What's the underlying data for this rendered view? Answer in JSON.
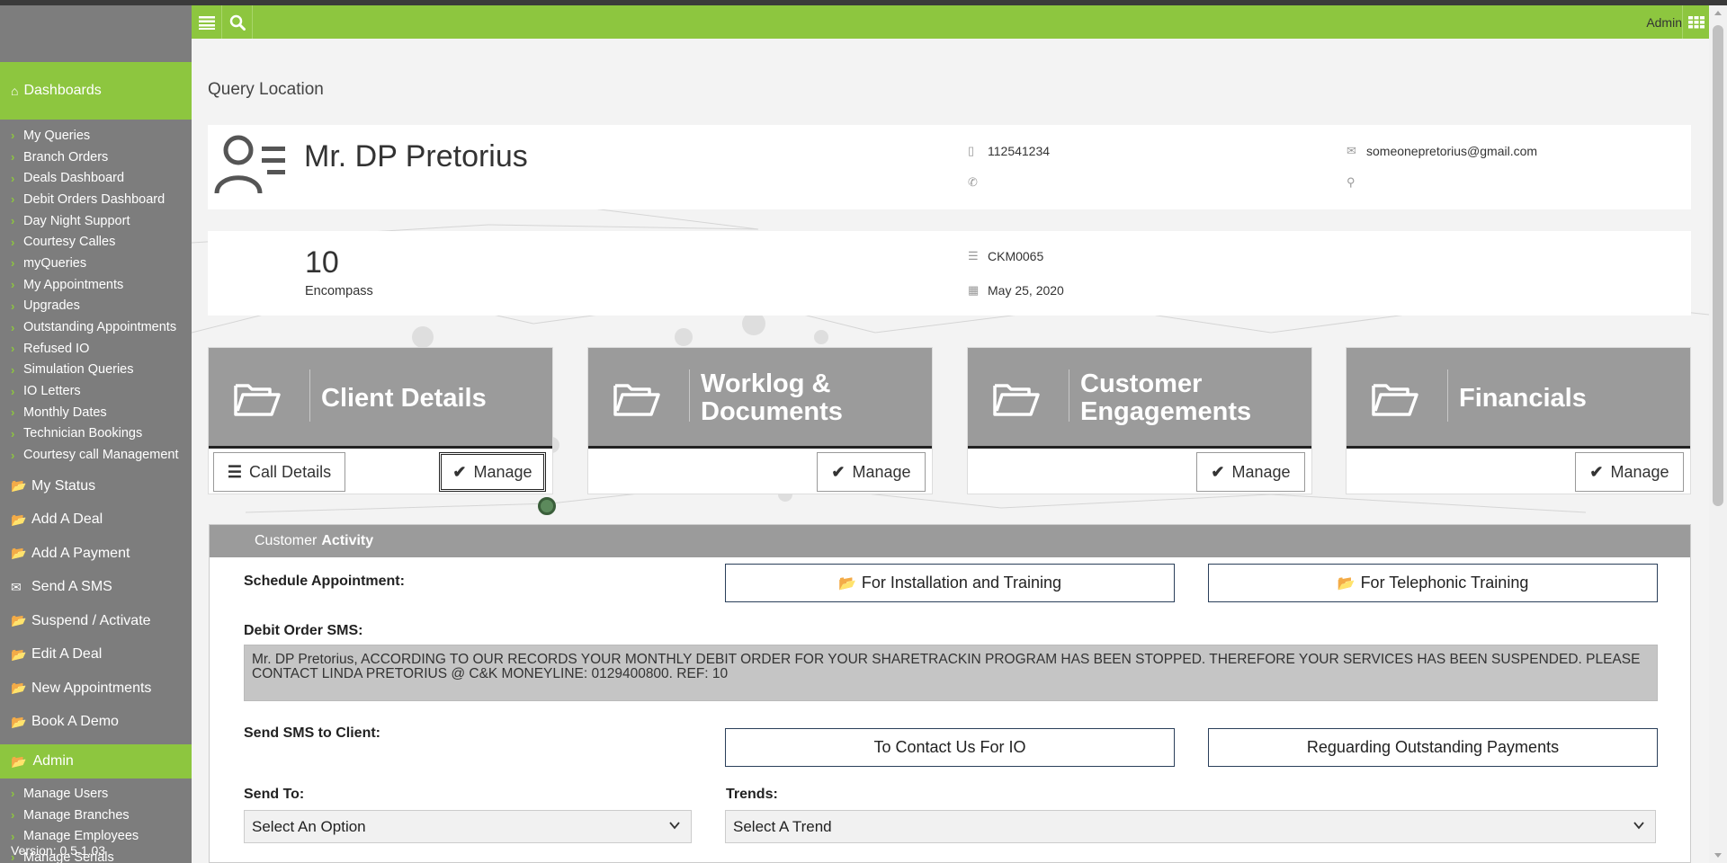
{
  "sidebar": {
    "dashboards": "Dashboards",
    "dashboard_items": [
      "My Queries",
      "Branch Orders",
      "Deals Dashboard",
      "Debit Orders Dashboard",
      "Day Night Support",
      "Courtesy Calles",
      "myQueries",
      "My Appointments",
      "Upgrades",
      "Outstanding Appointments",
      "Refused IO",
      "Simulation Queries",
      "IO Letters",
      "Monthly Dates",
      "Technician Bookings",
      "Courtesy call Management"
    ],
    "main_items": [
      "My Status",
      "Add A Deal",
      "Add A Payment",
      "Send A SMS",
      "Suspend / Activate",
      "Edit A Deal",
      "New Appointments",
      "Book A Demo"
    ],
    "admin": "Admin",
    "admin_items": [
      "Manage Users",
      "Manage Branches",
      "Manage Employees",
      "Manage Serials"
    ],
    "version": "Version: 0.5.1.03"
  },
  "topbar": {
    "user": "Admin"
  },
  "page_title": "Query Location",
  "client": {
    "name": "Mr. DP Pretorius",
    "mobile": "112541234",
    "phone": "",
    "email": "someonepretorius@gmail.com",
    "address": ""
  },
  "deal": {
    "number": "10",
    "product": "Encompass",
    "code": "CKM0065",
    "date": "May 25, 2020"
  },
  "tiles": [
    {
      "title_1": "Client Details",
      "title_2": "",
      "call_details": "Call Details",
      "manage": "Manage"
    },
    {
      "title_1": "Worklog &",
      "title_2": "Documents",
      "manage": "Manage"
    },
    {
      "title_1": "Customer",
      "title_2": "Engagements",
      "manage": "Manage"
    },
    {
      "title_1": "Financials",
      "title_2": "",
      "manage": "Manage"
    }
  ],
  "activity": {
    "title_prefix": "Customer",
    "title_bold": "Activity",
    "schedule_label": "Schedule Appointment:",
    "install_btn": "For Installation and Training",
    "telephonic_btn": "For Telephonic Training",
    "debit_label": "Debit Order SMS:",
    "debit_text": "Mr. DP Pretorius, ACCORDING TO OUR RECORDS YOUR MONTHLY DEBIT ORDER FOR YOUR SHARETRACKIN PROGRAM HAS BEEN STOPPED. THEREFORE YOUR SERVICES HAS BEEN SUSPENDED. PLEASE CONTACT LINDA PRETORIUS @ C&K MONEYLINE: 0129400800. REF: 10",
    "send_sms_label": "Send SMS to Client:",
    "contact_btn": "To Contact Us For IO",
    "outstanding_btn": "Reguarding Outstanding Payments",
    "send_to_label": "Send To:",
    "send_to_value": "Select An Option",
    "trends_label": "Trends:",
    "trends_value": "Select A Trend"
  },
  "colors": {
    "accent": "#8dc63f",
    "sidebar": "#7d7d7d",
    "tile_head": "#9b9b9b"
  }
}
